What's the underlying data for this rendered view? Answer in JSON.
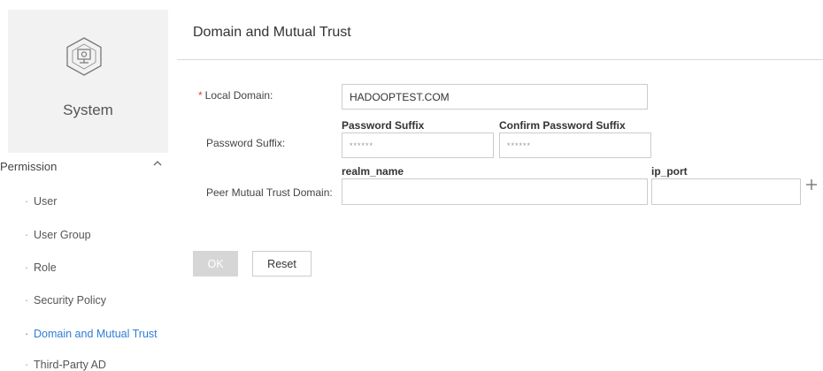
{
  "sidebar": {
    "system_label": "System",
    "section_label": "Permission",
    "items": [
      {
        "label": "User"
      },
      {
        "label": "User Group"
      },
      {
        "label": "Role"
      },
      {
        "label": "Security Policy"
      },
      {
        "label": "Domain and Mutual Trust",
        "active": true
      },
      {
        "label": "Third-Party AD"
      }
    ]
  },
  "page": {
    "title": "Domain and Mutual Trust"
  },
  "form": {
    "local_domain": {
      "label": "Local Domain:",
      "required_mark": "*",
      "value": "HADOOPTEST.COM"
    },
    "password_suffix": {
      "label": "Password Suffix:",
      "password_header": "Password Suffix",
      "confirm_header": "Confirm Password Suffix",
      "password_value": "******",
      "confirm_value": "******"
    },
    "peer_trust": {
      "label": "Peer Mutual Trust Domain:",
      "realm_header": "realm_name",
      "ip_header": "ip_port",
      "realm_value": "",
      "ip_value": ""
    }
  },
  "buttons": {
    "ok": "OK",
    "reset": "Reset"
  },
  "colors": {
    "accent": "#2f7cd6",
    "required": "#e0443a",
    "disabled_button": "#d6d6d6"
  }
}
